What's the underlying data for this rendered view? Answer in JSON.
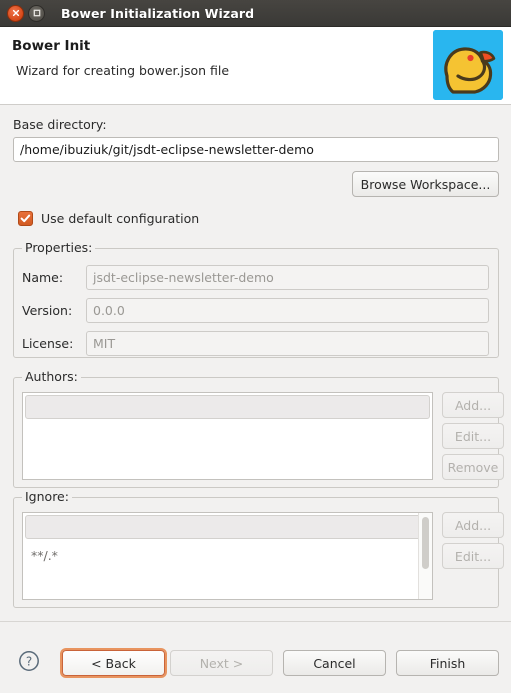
{
  "window": {
    "title": "Bower Initialization Wizard",
    "close_icon": "close-icon",
    "maximize_icon": "maximize-icon"
  },
  "header": {
    "title": "Bower Init",
    "subtitle": "Wizard for creating bower.json file",
    "logo_icon": "bower-duck-logo",
    "logo_bg": "#29b6ef",
    "logo_duck": "#f5c332",
    "logo_outline": "#4a3a1c",
    "logo_beak": "#f04e23"
  },
  "base_directory": {
    "label": "Base directory:",
    "value": "/home/ibuziuk/git/jsdt-eclipse-newsletter-demo",
    "browse_label": "Browse Workspace..."
  },
  "use_default": {
    "label": "Use default configuration",
    "checked": true,
    "check_icon": "checkmark-icon",
    "accent": "#d95f25"
  },
  "properties": {
    "group_label": "Properties:",
    "fields": [
      {
        "label": "Name:",
        "value": "jsdt-eclipse-newsletter-demo",
        "disabled": true
      },
      {
        "label": "Version:",
        "value": "0.0.0",
        "disabled": true
      },
      {
        "label": "License:",
        "value": "MIT",
        "disabled": true
      }
    ]
  },
  "authors": {
    "group_label": "Authors:",
    "items": [
      ""
    ],
    "buttons": [
      {
        "label": "Add...",
        "disabled": true
      },
      {
        "label": "Edit...",
        "disabled": true
      },
      {
        "label": "Remove",
        "disabled": true
      }
    ]
  },
  "ignore": {
    "group_label": "Ignore:",
    "items": [
      "",
      "**/.*"
    ],
    "buttons": [
      {
        "label": "Add...",
        "disabled": true
      },
      {
        "label": "Edit...",
        "disabled": true
      }
    ]
  },
  "footer": {
    "help_icon": "help-question-icon",
    "buttons": [
      {
        "label": "< Back",
        "disabled": false,
        "focused": true
      },
      {
        "label": "Next >",
        "disabled": true,
        "focused": false
      },
      {
        "label": "Cancel",
        "disabled": false,
        "focused": false
      },
      {
        "label": "Finish",
        "disabled": false,
        "focused": false
      }
    ]
  }
}
